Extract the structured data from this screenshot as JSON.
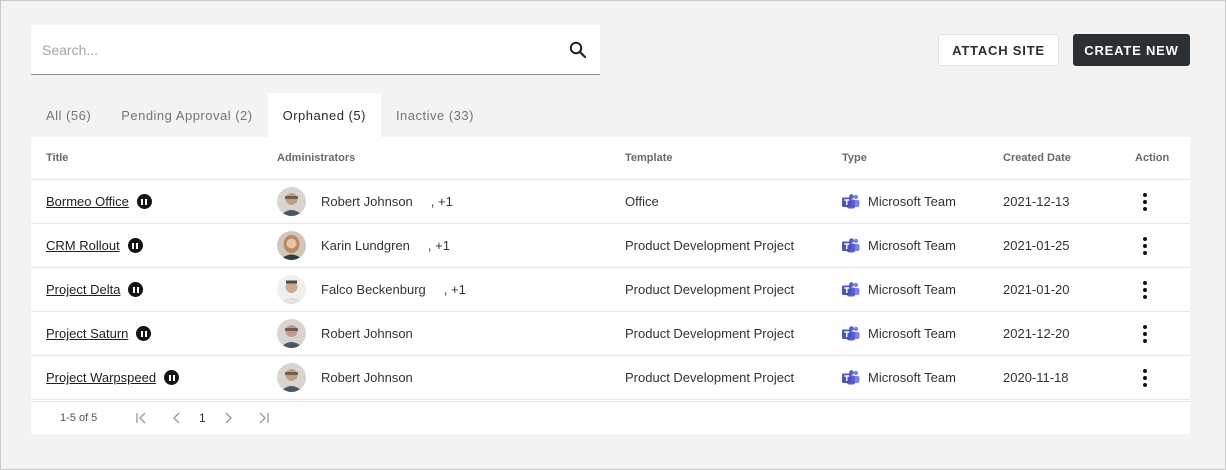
{
  "search": {
    "placeholder": "Search...",
    "icon": "search-icon"
  },
  "actions": {
    "attach_label": "ATTACH SITE",
    "create_label": "CREATE NEW"
  },
  "tabs": [
    {
      "label": "All (56)",
      "active": false
    },
    {
      "label": "Pending Approval (2)",
      "active": false
    },
    {
      "label": "Orphaned (5)",
      "active": true
    },
    {
      "label": "Inactive (33)",
      "active": false
    }
  ],
  "table": {
    "columns": [
      "Title",
      "Administrators",
      "Template",
      "Type",
      "Created Date",
      "Action"
    ],
    "rows": [
      {
        "title": "Bormeo Office",
        "admin": "Robert Johnson",
        "admin_more": ", +1",
        "template": "Office",
        "type": "Microsoft Team",
        "date": "2021-12-13"
      },
      {
        "title": "CRM Rollout",
        "admin": "Karin Lundgren",
        "admin_more": ", +1",
        "template": "Product Development Project",
        "type": "Microsoft Team",
        "date": "2021-01-25"
      },
      {
        "title": "Project Delta",
        "admin": "Falco Beckenburg",
        "admin_more": ", +1",
        "template": "Product Development Project",
        "type": "Microsoft Team",
        "date": "2021-01-20"
      },
      {
        "title": "Project Saturn",
        "admin": "Robert Johnson",
        "admin_more": "",
        "template": "Product Development Project",
        "type": "Microsoft Team",
        "date": "2021-12-20"
      },
      {
        "title": "Project Warpspeed",
        "admin": "Robert Johnson",
        "admin_more": "",
        "template": "Product Development Project",
        "type": "Microsoft Team",
        "date": "2020-11-18"
      }
    ]
  },
  "pager": {
    "range": "1-5 of 5",
    "page": "1"
  },
  "colors": {
    "primary_button": "#2b3035",
    "teams_purple": "#5b5fc7",
    "background": "#f3f3f3"
  }
}
